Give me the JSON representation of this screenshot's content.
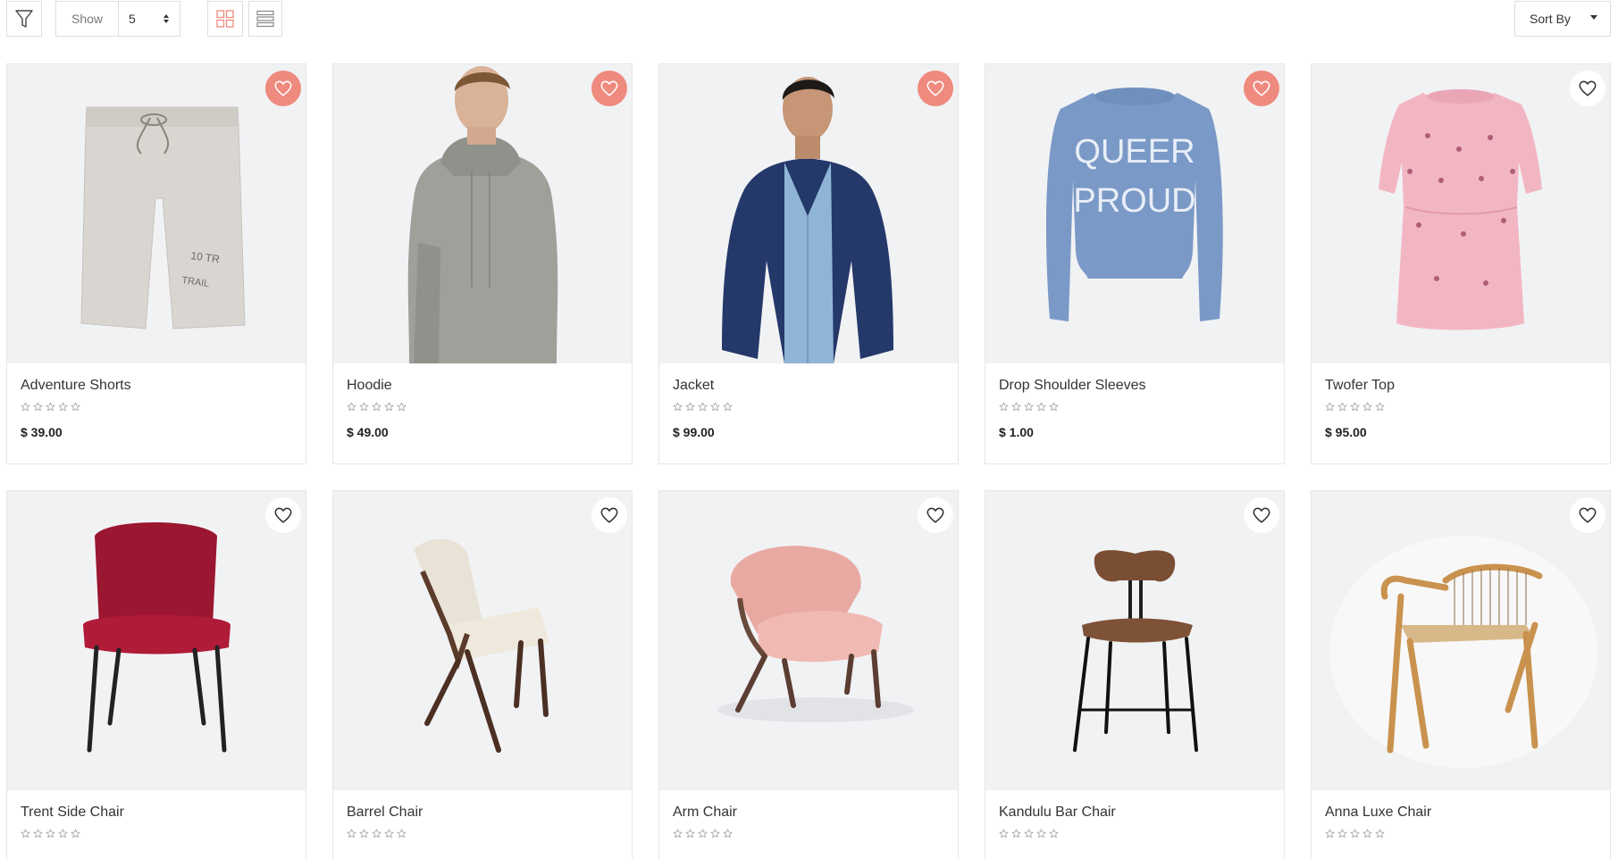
{
  "toolbar": {
    "show_label": "Show",
    "show_value": "5",
    "sort_label": "Sort By",
    "accent_color": "#ef8a7e"
  },
  "products": [
    {
      "name": "Adventure Shorts",
      "price": "$ 39.00",
      "rating": 0,
      "wishlisted": true
    },
    {
      "name": "Hoodie",
      "price": "$ 49.00",
      "rating": 0,
      "wishlisted": true
    },
    {
      "name": "Jacket",
      "price": "$ 99.00",
      "rating": 0,
      "wishlisted": true
    },
    {
      "name": "Drop Shoulder Sleeves",
      "price": "$ 1.00",
      "rating": 0,
      "wishlisted": true,
      "print_line1": "QUEER",
      "print_line2": "PROUD"
    },
    {
      "name": "Twofer Top",
      "price": "$ 95.00",
      "rating": 0,
      "wishlisted": false
    },
    {
      "name": "Trent Side Chair",
      "price": "",
      "rating": 0,
      "wishlisted": false
    },
    {
      "name": "Barrel Chair",
      "price": "",
      "rating": 0,
      "wishlisted": false
    },
    {
      "name": "Arm Chair",
      "price": "",
      "rating": 0,
      "wishlisted": false
    },
    {
      "name": "Kandulu Bar Chair",
      "price": "",
      "rating": 0,
      "wishlisted": false
    },
    {
      "name": "Anna Luxe Chair",
      "price": "",
      "rating": 0,
      "wishlisted": false
    }
  ]
}
